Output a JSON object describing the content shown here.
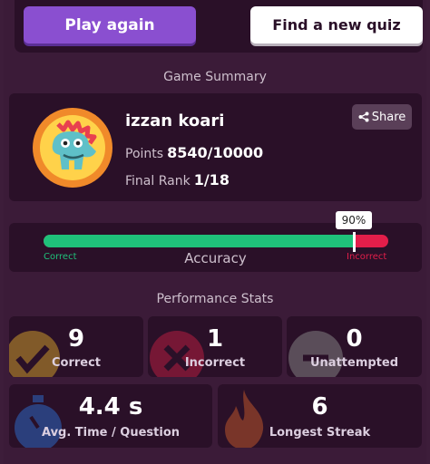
{
  "actions": {
    "play_again": "Play again",
    "find_quiz": "Find a new quiz"
  },
  "summary": {
    "title": "Game Summary",
    "player_name": "izzan koari",
    "points_label": "Points",
    "points_value": "8540/10000",
    "rank_label": "Final Rank",
    "rank_value": "1/18",
    "share_label": "Share",
    "avatar_icon": "dinosaur-avatar-icon"
  },
  "accuracy": {
    "title": "Accuracy",
    "percent_label": "90%",
    "percent": 90,
    "correct_label": "Correct",
    "incorrect_label": "Incorrect",
    "colors": {
      "correct": "#1fc17a",
      "incorrect": "#e31e4a"
    }
  },
  "performance": {
    "title": "Performance Stats",
    "tiles": [
      {
        "value": "9",
        "label": "Correct",
        "icon": "checkmark-icon",
        "color": "#d7a32b"
      },
      {
        "value": "1",
        "label": "Incorrect",
        "icon": "cross-icon",
        "color": "#c21e43"
      },
      {
        "value": "0",
        "label": "Unattempted",
        "icon": "minus-icon",
        "color": "#8a8a8a"
      },
      {
        "value": "4.4 s",
        "label": "Avg. Time / Question",
        "icon": "stopwatch-icon",
        "color": "#2d6fd0"
      },
      {
        "value": "6",
        "label": "Longest Streak",
        "icon": "flame-icon",
        "color": "#c85a2a"
      }
    ]
  }
}
